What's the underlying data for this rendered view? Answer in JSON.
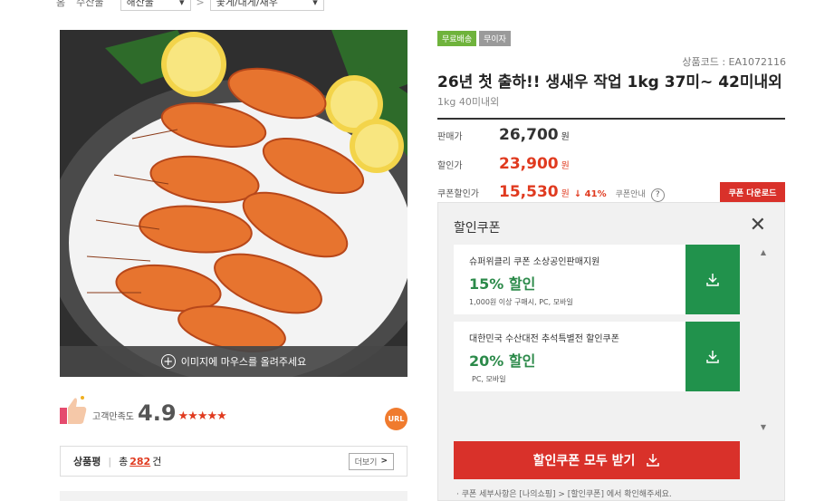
{
  "breadcrumb": {
    "home": "홈",
    "level1": "수산물",
    "select1": "해산물",
    "select2": "꽃게/대게/새우"
  },
  "image": {
    "hover_hint": "이미지에 마우스를 올려주세요"
  },
  "rating": {
    "label": "고객만족도",
    "score": "4.9",
    "stars": "★★★★★",
    "url_label": "URL"
  },
  "reviews": {
    "title": "상품평",
    "prefix": "총",
    "count": "282",
    "suffix": "건",
    "more_label": "더보기"
  },
  "product": {
    "badges": [
      "무료배송",
      "무이자"
    ],
    "code": "상품코드 : EA1072116",
    "title": "26년 첫 출하!! 생새우 작업 1kg 37미~ 42미내외",
    "subtitle": "1kg 40미내외"
  },
  "prices": {
    "sale_label": "판매가",
    "sale_value": "26,700",
    "discount_label": "할인가",
    "discount_value": "23,900",
    "coupon_label": "쿠폰할인가",
    "coupon_value": "15,530",
    "unit": "원",
    "coupon_rate": "↓ 41%",
    "coupon_info": "쿠폰안내",
    "help": "?",
    "coupon_download": "쿠폰 다운로드"
  },
  "coupon_panel": {
    "title": "할인쿠폰",
    "close": "✕",
    "coupons": [
      {
        "name": "슈퍼위클리 쿠폰 소상공인판매지원",
        "discount": "15% 할인",
        "condition": "1,000원 이상 구매시, PC, 모바일"
      },
      {
        "name": "대한민국 수산대전 추석특별전 할인쿠폰",
        "discount": "20% 할인",
        "condition": "PC, 모바일"
      }
    ],
    "all_button": "할인쿠폰 모두 받기",
    "note": "· 쿠폰 세부사항은 [나의쇼핑] > [할인쿠폰] 에서 확인해주세요."
  },
  "colors": {
    "accent_red": "#d9312a",
    "coupon_green": "#21924c",
    "badge_green": "#6fb33c"
  }
}
